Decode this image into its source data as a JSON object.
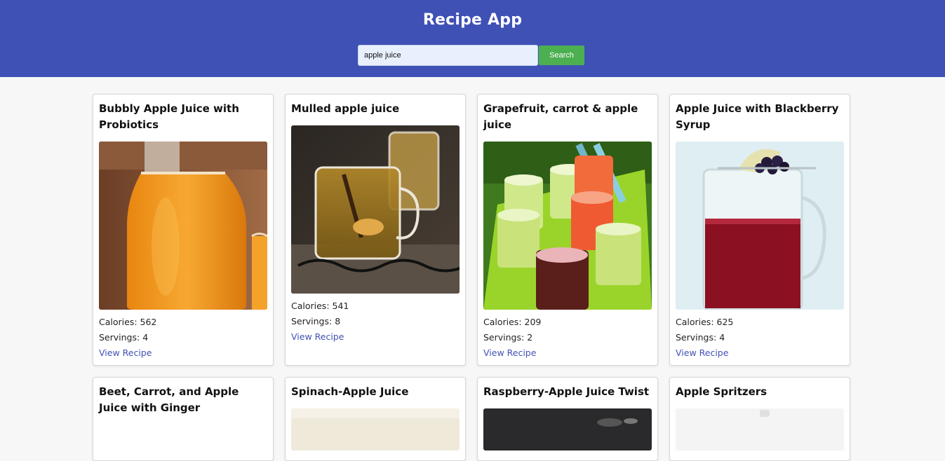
{
  "header": {
    "title": "Recipe App",
    "search_value": "apple juice",
    "search_button": "Search",
    "background": "#3f51b5",
    "button_color": "#4caf50"
  },
  "recipes": [
    {
      "title": "Bubbly Apple Juice with Probiotics",
      "calories_text": "Calories: 562",
      "servings_text": "Servings: 4",
      "link_text": "View Recipe",
      "image": "orange-juice-bottle"
    },
    {
      "title": "Mulled apple juice",
      "calories_text": "Calories: 541",
      "servings_text": "Servings: 8",
      "link_text": "View Recipe",
      "image": "mulled-juice-glasses"
    },
    {
      "title": "Grapefruit, carrot & apple juice",
      "calories_text": "Calories: 209",
      "servings_text": "Servings: 2",
      "link_text": "View Recipe",
      "image": "green-tray-glasses"
    },
    {
      "title": "Apple Juice with Blackberry Syrup",
      "calories_text": "Calories: 625",
      "servings_text": "Servings: 4",
      "link_text": "View Recipe",
      "image": "berry-pitcher"
    },
    {
      "title": "Beet, Carrot, and Apple Juice with Ginger",
      "image": "none"
    },
    {
      "title": "Spinach-Apple Juice",
      "image": "light"
    },
    {
      "title": "Raspberry-Apple Juice Twist",
      "image": "dark"
    },
    {
      "title": "Apple Spritzers",
      "image": "white"
    }
  ]
}
